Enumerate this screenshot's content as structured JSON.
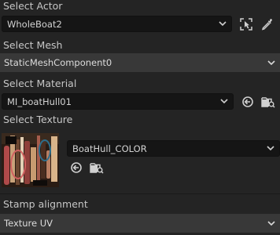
{
  "select_actor": {
    "label": "Select Actor",
    "value": "WholeBoat2"
  },
  "select_mesh": {
    "label": "Select Mesh",
    "value": "StaticMeshComponent0"
  },
  "select_material": {
    "label": "Select Material",
    "value": "MI_boatHull01"
  },
  "select_texture": {
    "label": "Select Texture",
    "value": "BoatHull_COLOR"
  },
  "stamp_alignment": {
    "label": "Stamp alignment",
    "value": "Texture UV"
  },
  "icons": {
    "actor_pick": "select-in-viewport-icon",
    "actor_eyedropper": "eyedropper-icon",
    "use_selected": "use-selected-asset-icon",
    "browse": "browse-to-asset-icon",
    "chevron": "chevron-down-icon"
  },
  "colors": {
    "background": "#242424",
    "field": "#151515",
    "bar": "#383838",
    "text": "#c8c8c8"
  }
}
